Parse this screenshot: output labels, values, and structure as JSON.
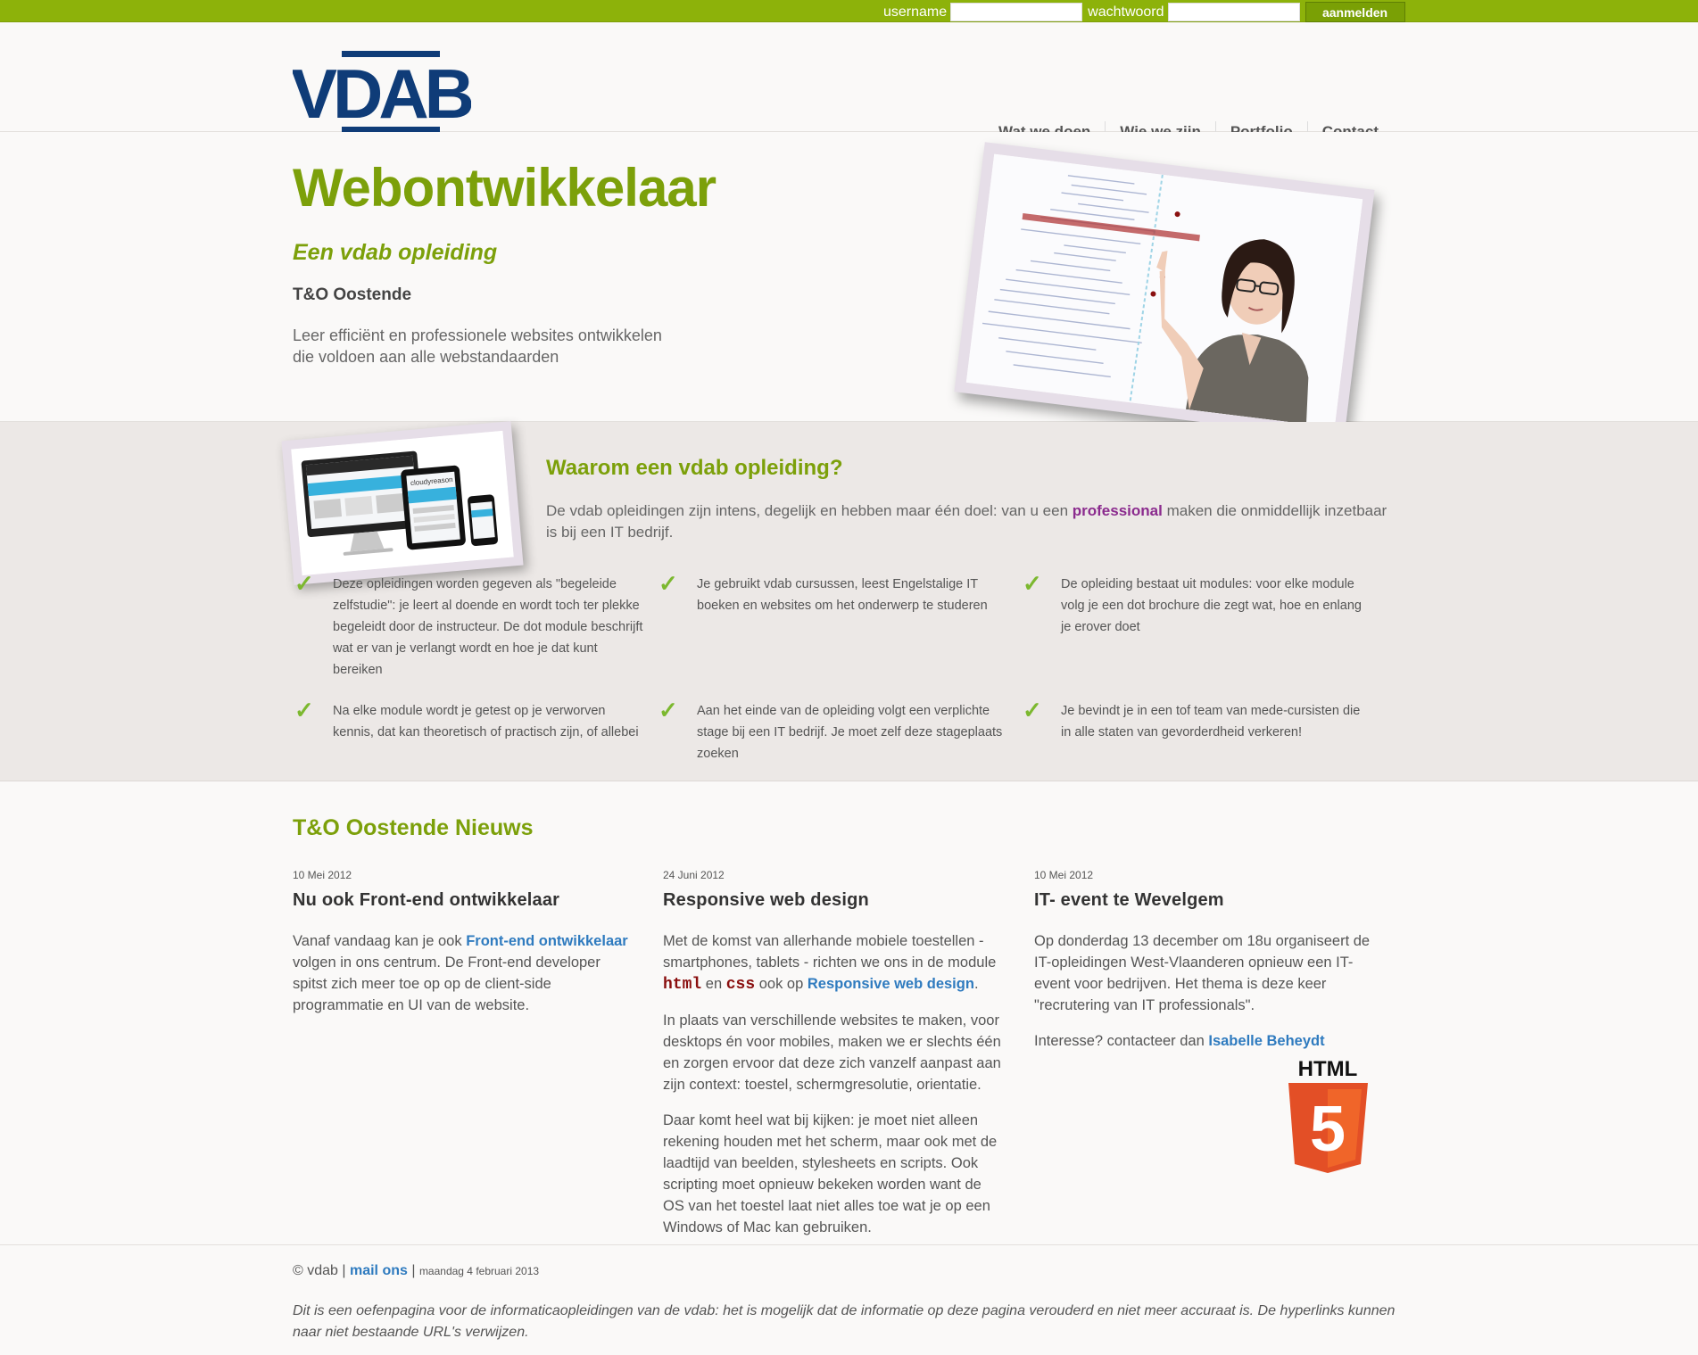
{
  "login": {
    "username_label": "username",
    "password_label": "wachtwoord",
    "submit_label": "aanmelden"
  },
  "logo": {
    "text": "VDAB"
  },
  "nav": {
    "items": [
      "Wat we doen",
      "Wie we zijn",
      "Portfolio",
      "Contact"
    ]
  },
  "hero": {
    "title": "Webontwikkelaar",
    "subtitle": "Een vdab opleiding",
    "location": "T&O Oostende",
    "intro_line1": "Leer efficiënt en professionele websites ontwikkelen",
    "intro_line2": "die voldoen aan alle webstandaarden",
    "photo_brand": "cloudyreason"
  },
  "why": {
    "title": "Waarom een vdab opleiding?",
    "lead_before": "De vdab opleidingen zijn intens, degelijk en hebben maar één doel: van u een ",
    "lead_highlight": "professional",
    "lead_after": " maken die onmiddellijk inzetbaar is bij een IT bedrijf.",
    "features": [
      "Deze opleidingen worden gegeven als \"begeleide zelfstudie\": je leert al doende en wordt toch ter plekke begeleidt door de instructeur. De dot module beschrijft wat er van je verlangt wordt en hoe je dat kunt bereiken",
      "Je gebruikt vdab cursussen, leest Engelstalige IT boeken en websites om het onderwerp te studeren",
      "De opleiding bestaat uit modules: voor elke module volg je een dot brochure die zegt wat, hoe en enlang je erover doet",
      "Na elke module wordt je getest op je verworven kennis, dat kan theoretisch of practisch zijn, of allebei",
      "Aan het einde van de opleiding volgt een verplichte stage bij een IT bedrijf. Je moet zelf deze stageplaats zoeken",
      "Je bevindt je in een tof team van mede-cursisten die in alle staten van gevorderdheid verkeren!"
    ]
  },
  "news": {
    "title": "T&O Oostende Nieuws",
    "col1": {
      "date": "10 Mei 2012",
      "title": "Nu ook Front-end ontwikkelaar",
      "p1_before": "Vanaf vandaag kan je ook ",
      "p1_link": "Front-end ontwikkelaar",
      "p1_after": " volgen in ons centrum. De Front-end developer spitst zich meer toe op op de client-side programmatie en UI van de website."
    },
    "col2": {
      "date": "24 Juni 2012",
      "title": "Responsive web design",
      "p1_before": "Met de komst van allerhande mobiele toestellen - smartphones, tablets - richten we ons in de module ",
      "p1_code1": "html",
      "p1_mid1": " en ",
      "p1_code2": "css",
      "p1_mid2": " ook op ",
      "p1_link": "Responsive web design",
      "p1_after": ".",
      "p2": "In plaats van verschillende websites te maken, voor desktops én voor mobiles, maken we er slechts één en zorgen ervoor dat deze zich vanzelf aanpast aan zijn context: toestel, schermgresolutie, orientatie.",
      "p3": "Daar komt heel wat bij kijken: je moet niet alleen rekening houden met het scherm, maar ook met de laadtijd van beelden, stylesheets en scripts. Ook scripting moet opnieuw bekeken worden want de OS van het toestel laat niet alles toe wat je op een Windows of Mac kan gebruiken."
    },
    "col3": {
      "date": "10 Mei 2012",
      "title": "IT- event te Wevelgem",
      "p1": "Op donderdag 13 december om 18u organiseert de IT-opleidingen West-Vlaanderen opnieuw een IT-event voor bedrijven. Het thema is deze keer \"recrutering van IT professionals\".",
      "p2_before": "Interesse? contacteer dan ",
      "p2_link": "Isabelle Beheydt"
    },
    "html5_label": "HTML",
    "html5_digit": "5"
  },
  "footer": {
    "copyright": "© vdab | ",
    "mail_link": "mail ons",
    "separator": " | ",
    "date": "maandag 4 februari 2013",
    "disclaimer": "Dit is een oefenpagina voor de informaticaopleidingen van de vdab: het is mogelijk dat de informatie op deze pagina verouderd en niet meer accuraat is. De hyperlinks kunnen naar niet bestaande URL's verwijzen."
  },
  "colors": {
    "brand_green": "#7ca00a",
    "topbar_green": "#8db20a",
    "logo_blue": "#0f3c78",
    "link_blue": "#2f7bbf",
    "highlight_purple": "#8b2b8e",
    "check_green": "#7cb82f"
  }
}
